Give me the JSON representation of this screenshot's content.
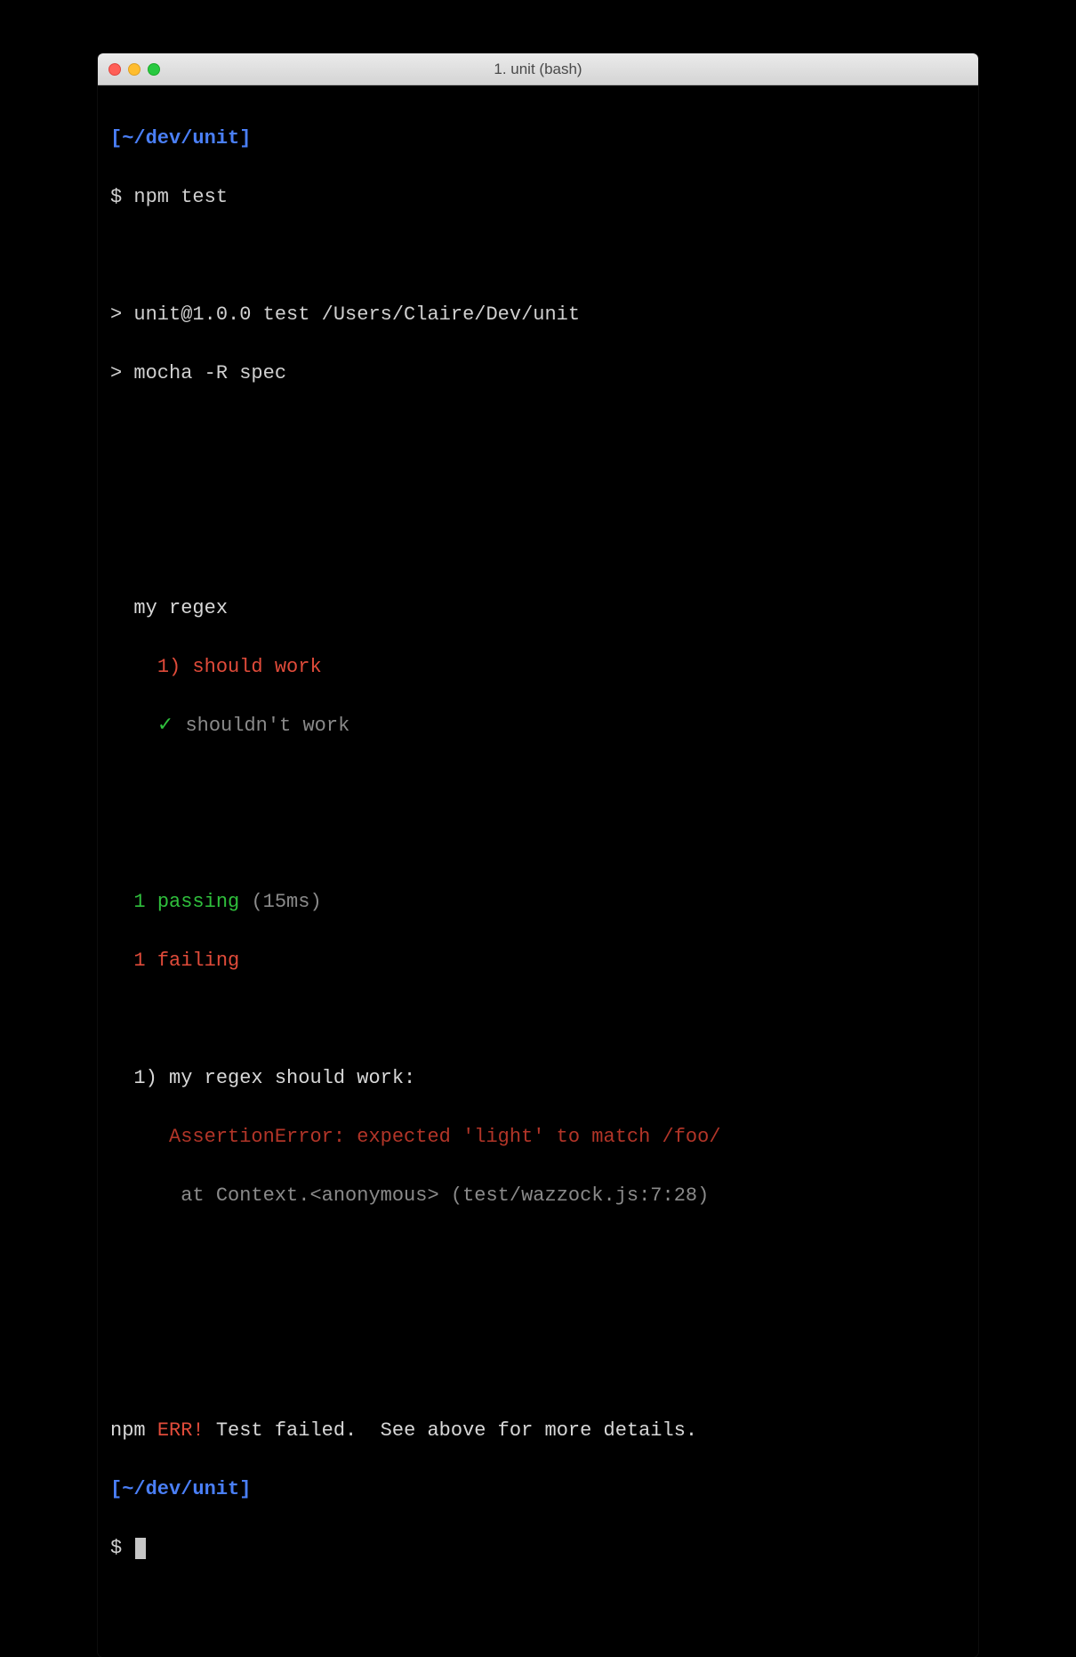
{
  "window": {
    "title": "1. unit (bash)"
  },
  "prompt": {
    "cwd": "~/dev/unit",
    "symbol": "$"
  },
  "commands": {
    "npm_test": "npm test"
  },
  "npm_header": {
    "line1": "> unit@1.0.0 test /Users/Claire/Dev/unit",
    "line2": "> mocha -R spec"
  },
  "mocha": {
    "suite": "my regex",
    "fail_item_num": "1)",
    "fail_item_label": "should work",
    "pass_check": "✓",
    "pass_item_label": "shouldn't work",
    "summary_pass_count": "1",
    "summary_pass_word": "passing",
    "summary_time": "(15ms)",
    "summary_fail_count": "1",
    "summary_fail_word": "failing",
    "error_heading_num": "1)",
    "error_heading_text": "my regex should work:",
    "assertion_error": "AssertionError: expected 'light' to match /foo/",
    "stack_line": "at Context.<anonymous> (test/wazzock.js:7:28)"
  },
  "npm_footer": {
    "prefix": "npm",
    "err": "ERR!",
    "message": "Test failed.  See above for more details."
  }
}
